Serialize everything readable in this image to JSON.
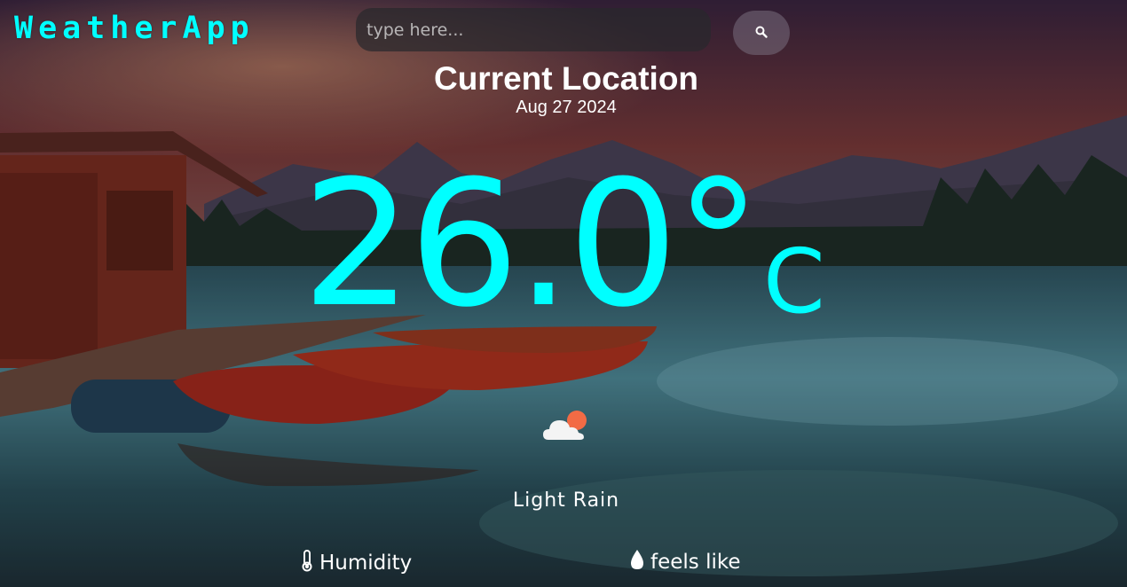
{
  "header": {
    "brand": "WeatherApp",
    "search_placeholder": "type here...",
    "search_icon": "search-icon"
  },
  "location": {
    "name": "Current Location",
    "date": "Aug 27 2024"
  },
  "weather": {
    "temperature": "26.0°",
    "unit": "C",
    "condition": "Light Rain",
    "condition_icon": "cloud-sun-icon"
  },
  "metrics": {
    "humidity_label": "Humidity",
    "humidity_icon": "thermometer-icon",
    "feels_like_label": "feels like",
    "feels_like_icon": "droplet-icon"
  },
  "colors": {
    "accent": "#00ffff"
  }
}
